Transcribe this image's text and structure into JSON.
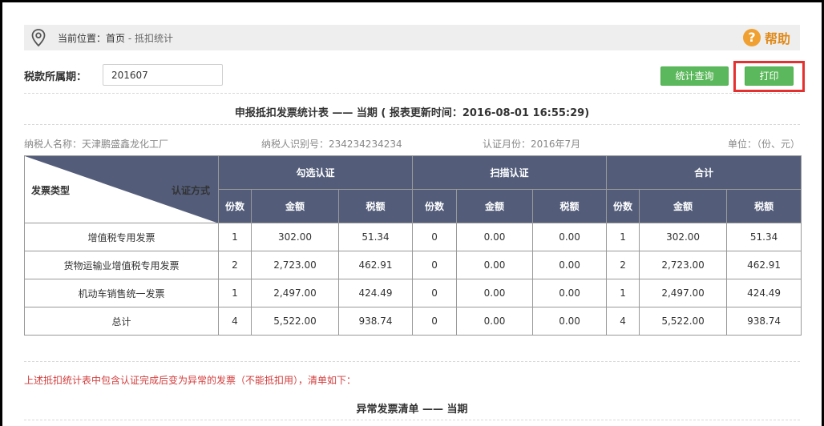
{
  "breadcrumb": {
    "prefix": "当前位置：",
    "home": "首页",
    "sep": " - ",
    "current": "抵扣统计"
  },
  "help": {
    "label": "帮助",
    "icon": "?"
  },
  "filter": {
    "label": "税款所属期：",
    "value": "201607"
  },
  "buttons": {
    "query": "统计查询",
    "print": "打印"
  },
  "report": {
    "title": "申报抵扣发票统计表 —— 当期 ( 报表更新时间：2016-08-01 16:55:29)",
    "taxpayer_name": "纳税人名称：天津鹏盛鑫龙化工厂",
    "taxpayer_id": "纳税人识别号：234234234234",
    "cert_month": "认证月份：2016年7月",
    "unit": "单位：（份、元）"
  },
  "table": {
    "corner_top": "认证方式",
    "corner_bottom": "发票类型",
    "groups": [
      "勾选认证",
      "扫描认证",
      "合计"
    ],
    "subheaders": [
      "份数",
      "金额",
      "税额"
    ],
    "rows": [
      [
        "增值税专用发票",
        "1",
        "302.00",
        "51.34",
        "0",
        "0.00",
        "0.00",
        "1",
        "302.00",
        "51.34"
      ],
      [
        "货物运输业增值税专用发票",
        "2",
        "2,723.00",
        "462.91",
        "0",
        "0.00",
        "0.00",
        "2",
        "2,723.00",
        "462.91"
      ],
      [
        "机动车销售统一发票",
        "1",
        "2,497.00",
        "424.49",
        "0",
        "0.00",
        "0.00",
        "1",
        "2,497.00",
        "424.49"
      ],
      [
        "总计",
        "4",
        "5,522.00",
        "938.74",
        "0",
        "0.00",
        "0.00",
        "4",
        "5,522.00",
        "938.74"
      ]
    ]
  },
  "notice": "上述抵扣统计表中包含认证完成后变为异常的发票（不能抵扣用），清单如下：",
  "abnormal_title": "异常发票清单 —— 当期",
  "colors": {
    "header_bg": "#535d7a",
    "button_green": "#5cb85c",
    "highlight_red": "#e53030",
    "warning_red": "#d23c3c",
    "help_orange": "#f0a030"
  },
  "icons": {
    "location": "location-pin-icon",
    "help": "help-circle-icon"
  }
}
